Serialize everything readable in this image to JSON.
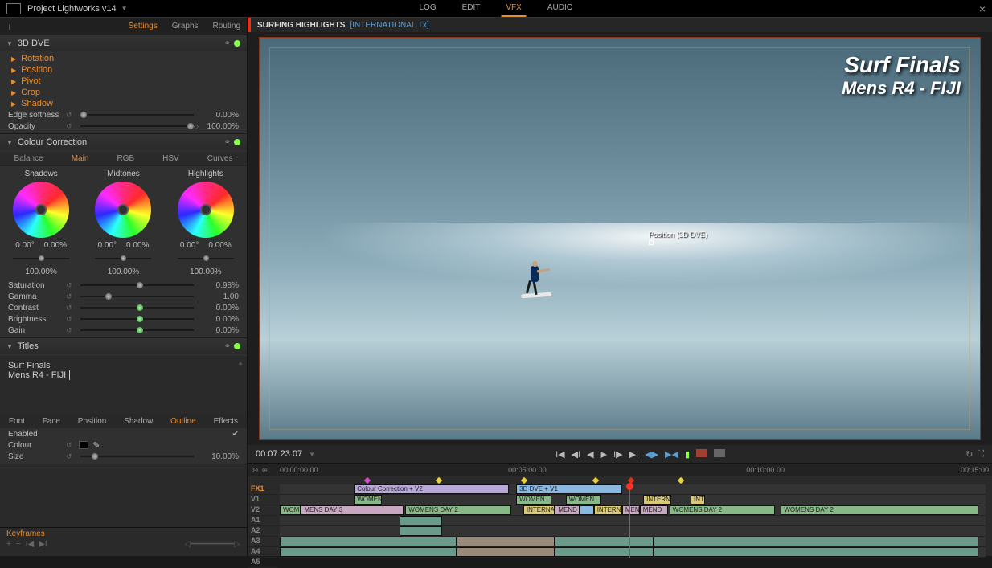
{
  "titlebar": {
    "project": "Project Lightworks v14"
  },
  "mainTabs": {
    "t0": "LOG",
    "t1": "EDIT",
    "t2": "VFX",
    "t3": "AUDIO"
  },
  "sidebarTabs": {
    "t0": "Settings",
    "t1": "Graphs",
    "t2": "Routing"
  },
  "dve": {
    "title": "3D DVE",
    "rotation": "Rotation",
    "position": "Position",
    "pivot": "Pivot",
    "crop": "Crop",
    "shadow": "Shadow",
    "edgeSoft": {
      "label": "Edge softness",
      "value": "0.00%"
    },
    "opacity": {
      "label": "Opacity",
      "value": "100.00%"
    }
  },
  "cc": {
    "title": "Colour Correction",
    "tabs": {
      "t0": "Balance",
      "t1": "Main",
      "t2": "RGB",
      "t3": "HSV",
      "t4": "Curves"
    },
    "wheels": {
      "shadows": {
        "label": "Shadows",
        "hue": "0.00°",
        "sat": "0.00%",
        "lum": "100.00%"
      },
      "midtones": {
        "label": "Midtones",
        "hue": "0.00°",
        "sat": "0.00%",
        "lum": "100.00%"
      },
      "highlights": {
        "label": "Highlights",
        "hue": "0.00°",
        "sat": "0.00%",
        "lum": "100.00%"
      }
    },
    "sliders": {
      "saturation": {
        "label": "Saturation",
        "value": "0.98%"
      },
      "gamma": {
        "label": "Gamma",
        "value": "1.00"
      },
      "contrast": {
        "label": "Contrast",
        "value": "0.00%"
      },
      "brightness": {
        "label": "Brightness",
        "value": "0.00%"
      },
      "gain": {
        "label": "Gain",
        "value": "0.00%"
      }
    }
  },
  "titles": {
    "title": "Titles",
    "line1": "Surf Finals",
    "line2": "Mens R4 - FIJI",
    "tabs": {
      "t0": "Font",
      "t1": "Face",
      "t2": "Position",
      "t3": "Shadow",
      "t4": "Outline",
      "t5": "Effects"
    },
    "enabled": {
      "label": "Enabled"
    },
    "colour": {
      "label": "Colour"
    },
    "size": {
      "label": "Size",
      "value": "10.00%"
    }
  },
  "keyframes": {
    "label": "Keyframes"
  },
  "clipHeader": {
    "name": "SURFING HIGHLIGHTS",
    "sub": "[INTERNATIONAL Tx]"
  },
  "preview": {
    "titleL1": "Surf Finals",
    "titleL2": "Mens R4 - FIJI",
    "posLabel": "Position (3D DVE)"
  },
  "transport": {
    "timecode": "00:07:23.07"
  },
  "ruler": {
    "t0": "00:00:00.00",
    "t1": "00:05:00.00",
    "t2": "00:10:00.00",
    "t3": "00:15:00"
  },
  "tracks": {
    "labels": {
      "fx1": "FX1",
      "v1": "V1",
      "v2": "V2",
      "a1": "A1",
      "a2": "A2",
      "a3": "A3",
      "a4": "A4",
      "a5": "A5"
    },
    "fx1": {
      "c0": "Colour Correction + V2",
      "c1": "3D DVE + V1"
    },
    "v1": {
      "c0": "WOMEN",
      "c1": "WOMEN",
      "c2": "WOMEN",
      "c3": "INTERNA",
      "c4": "INT"
    },
    "v2": {
      "c0": "WOM",
      "c1": "MENS DAY 3",
      "c2": "WOMENS DAY 2",
      "c3": "INTERNA",
      "c4": "MEND",
      "c5": "INTERNA",
      "c6": "MEN",
      "c7": "MEND",
      "c8": "WOMENS DAY 2",
      "c9": "WOMENS DAY 2"
    }
  }
}
